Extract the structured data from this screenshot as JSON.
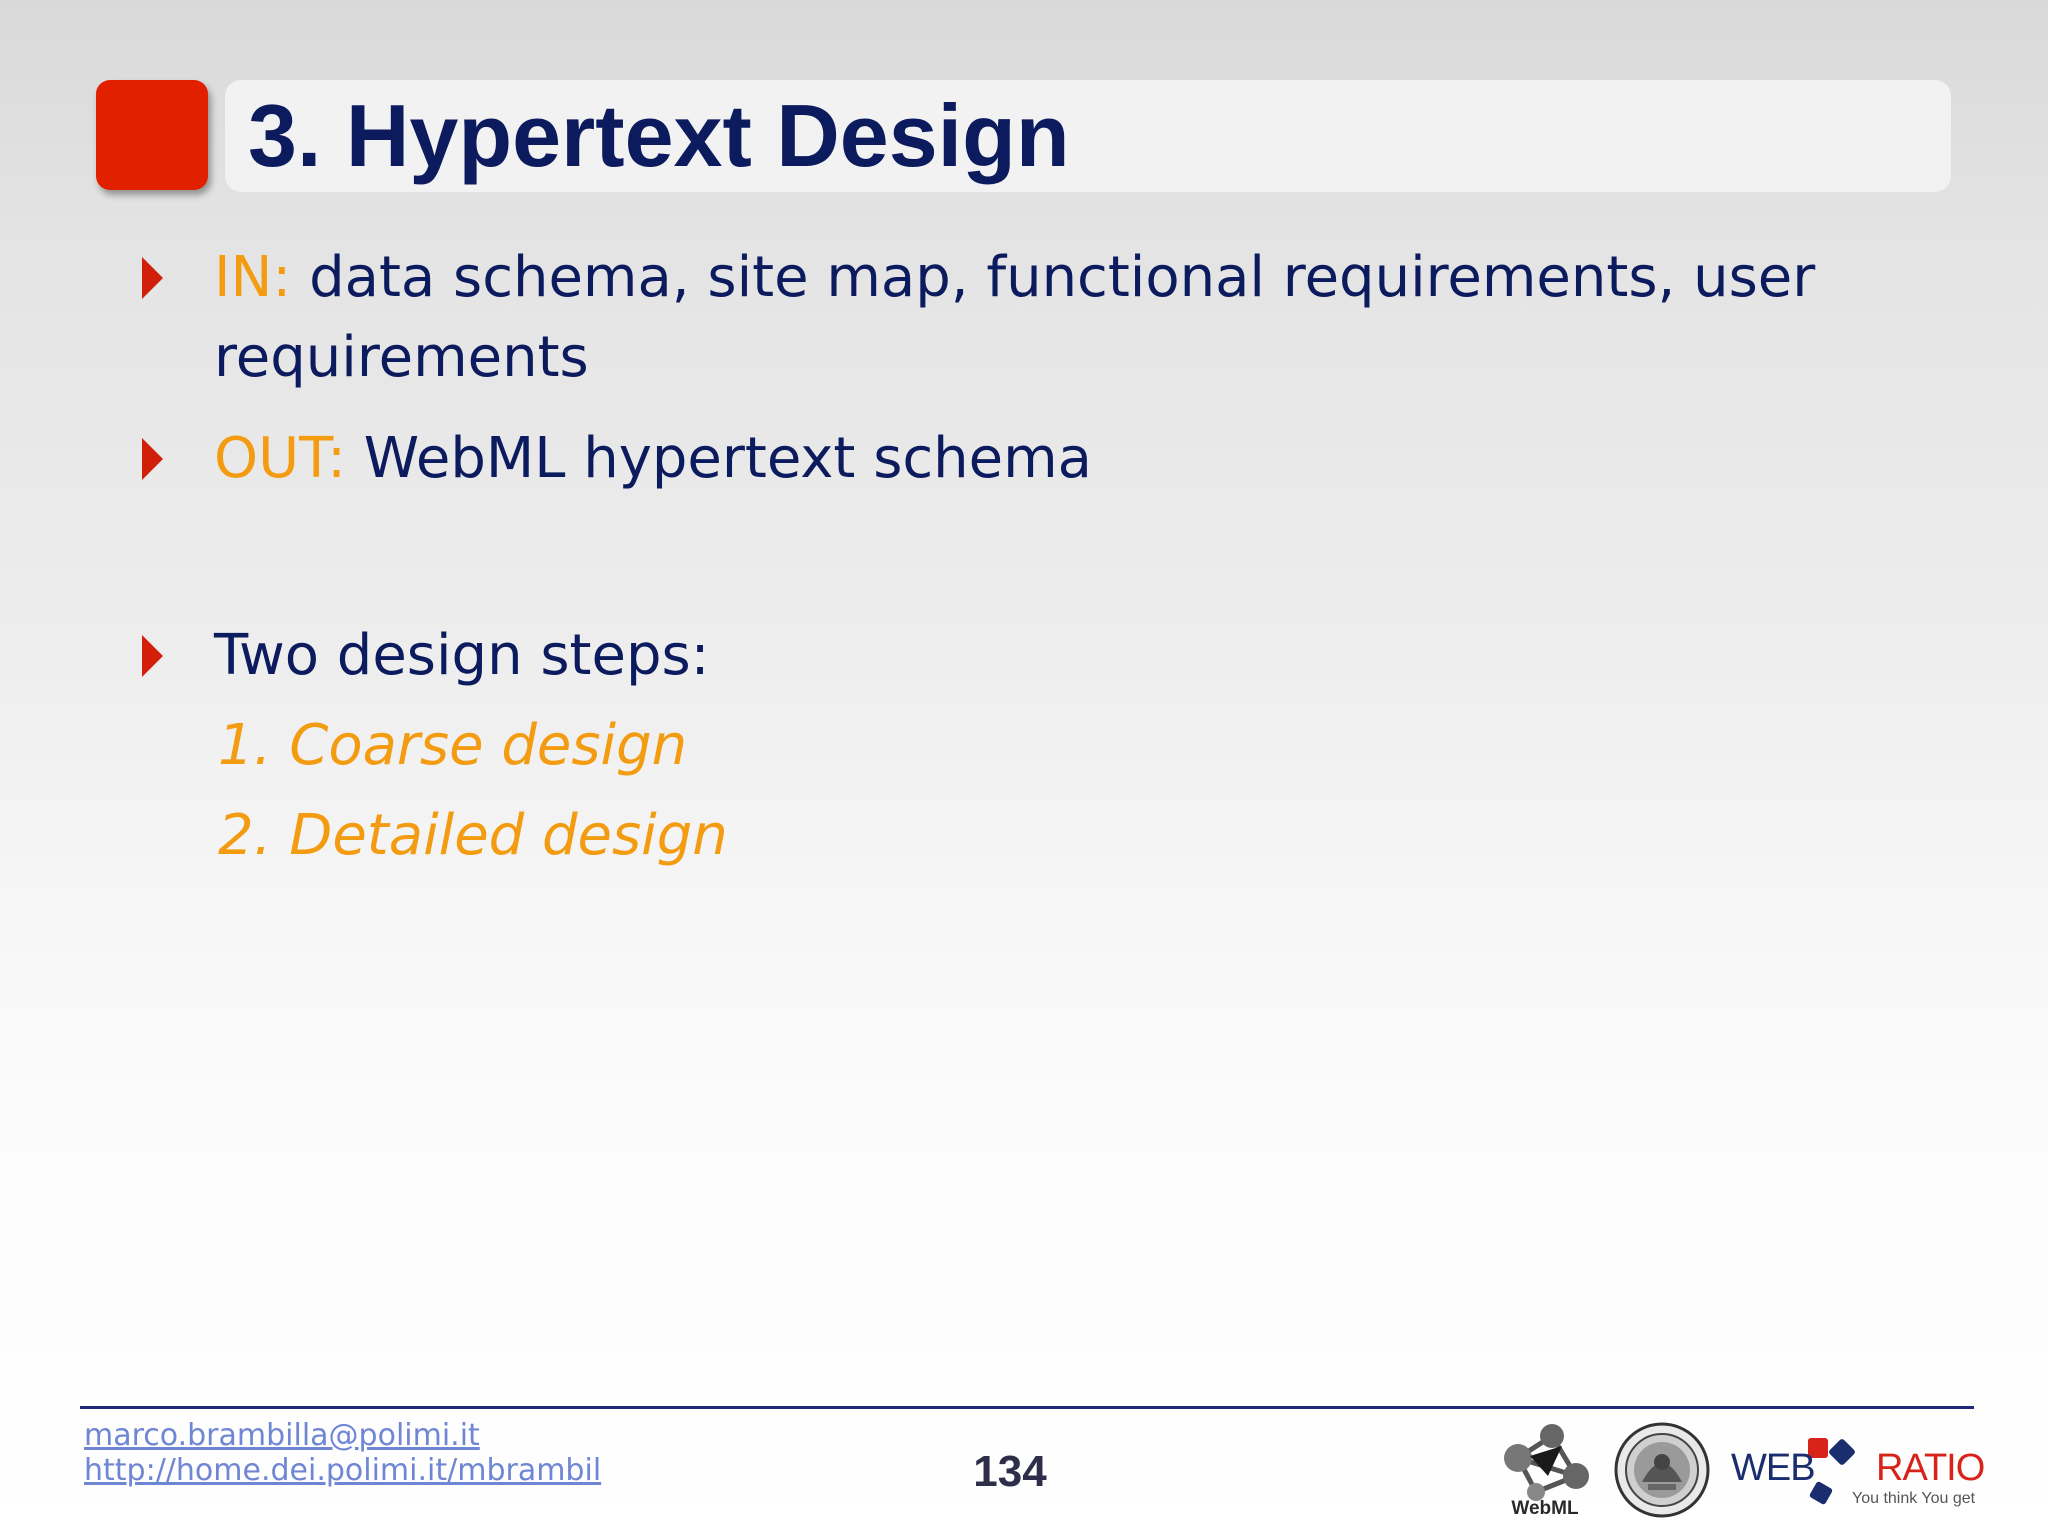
{
  "slide": {
    "title": "3. Hypertext Design",
    "bullets": [
      {
        "keyword": "IN:",
        "text_line1": " data schema, site map, functional requirements, user",
        "text_line2": "requirements"
      },
      {
        "keyword": "OUT:",
        "text": " WebML hypertext schema"
      },
      {
        "text": "Two design steps:",
        "steps": [
          "1. Coarse design",
          "2. Detailed design"
        ]
      }
    ]
  },
  "footer": {
    "email": "marco.brambilla@polimi.it",
    "url": "http://home.dei.polimi.it/mbrambil",
    "page_number": "134",
    "logos": {
      "webml_label": "WebML",
      "webratio_web": "WEB",
      "webratio_ratio": "RATIO",
      "webratio_tagline": "You think You get"
    }
  },
  "colors": {
    "title_text": "#0c1a5e",
    "accent_red": "#e12000",
    "keyword_orange": "#f39c12",
    "link_blue": "#6f86d4"
  }
}
